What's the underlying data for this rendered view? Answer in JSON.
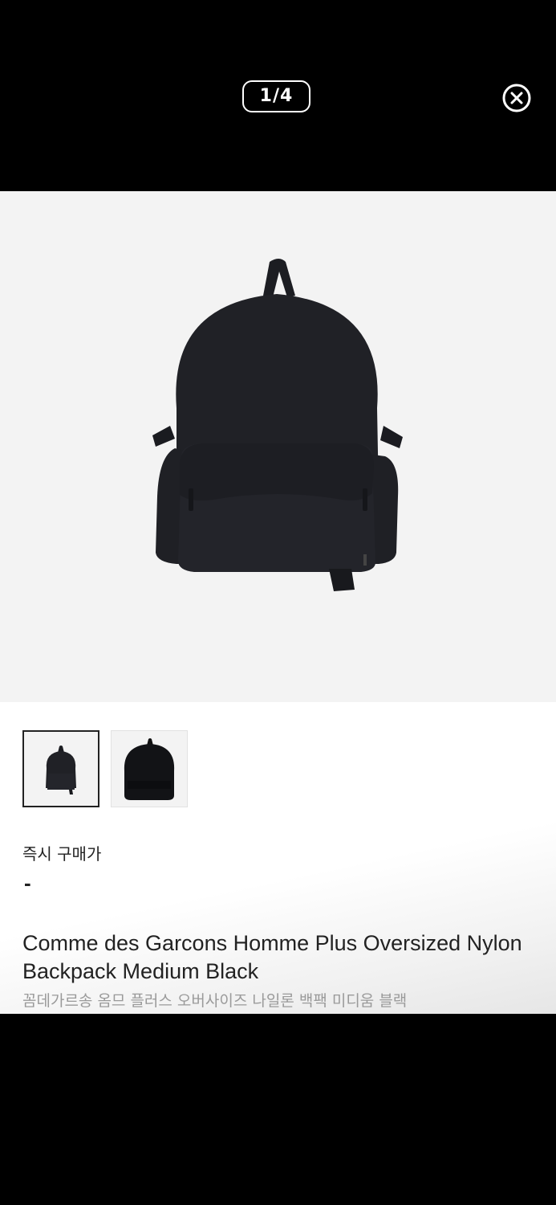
{
  "viewer": {
    "counter": "1/4",
    "close_icon": "close-circle-icon"
  },
  "thumbnails": [
    {
      "name": "backpack-front-thumb",
      "selected": true
    },
    {
      "name": "backpack-back-thumb",
      "selected": false
    }
  ],
  "price": {
    "label": "즉시 구매가",
    "value": "-"
  },
  "product": {
    "title_en": "Comme des Garcons Homme Plus Oversized Nylon Backpack Medium Black",
    "title_ko": "꼼데가르송 옴므 플러스 오버사이즈 나일론 백팩 미디움 블랙"
  },
  "colors": {
    "background_dark": "#000000",
    "viewer_bg": "#f3f3f3",
    "text_primary": "#222222",
    "text_secondary": "#9a9a9a"
  }
}
